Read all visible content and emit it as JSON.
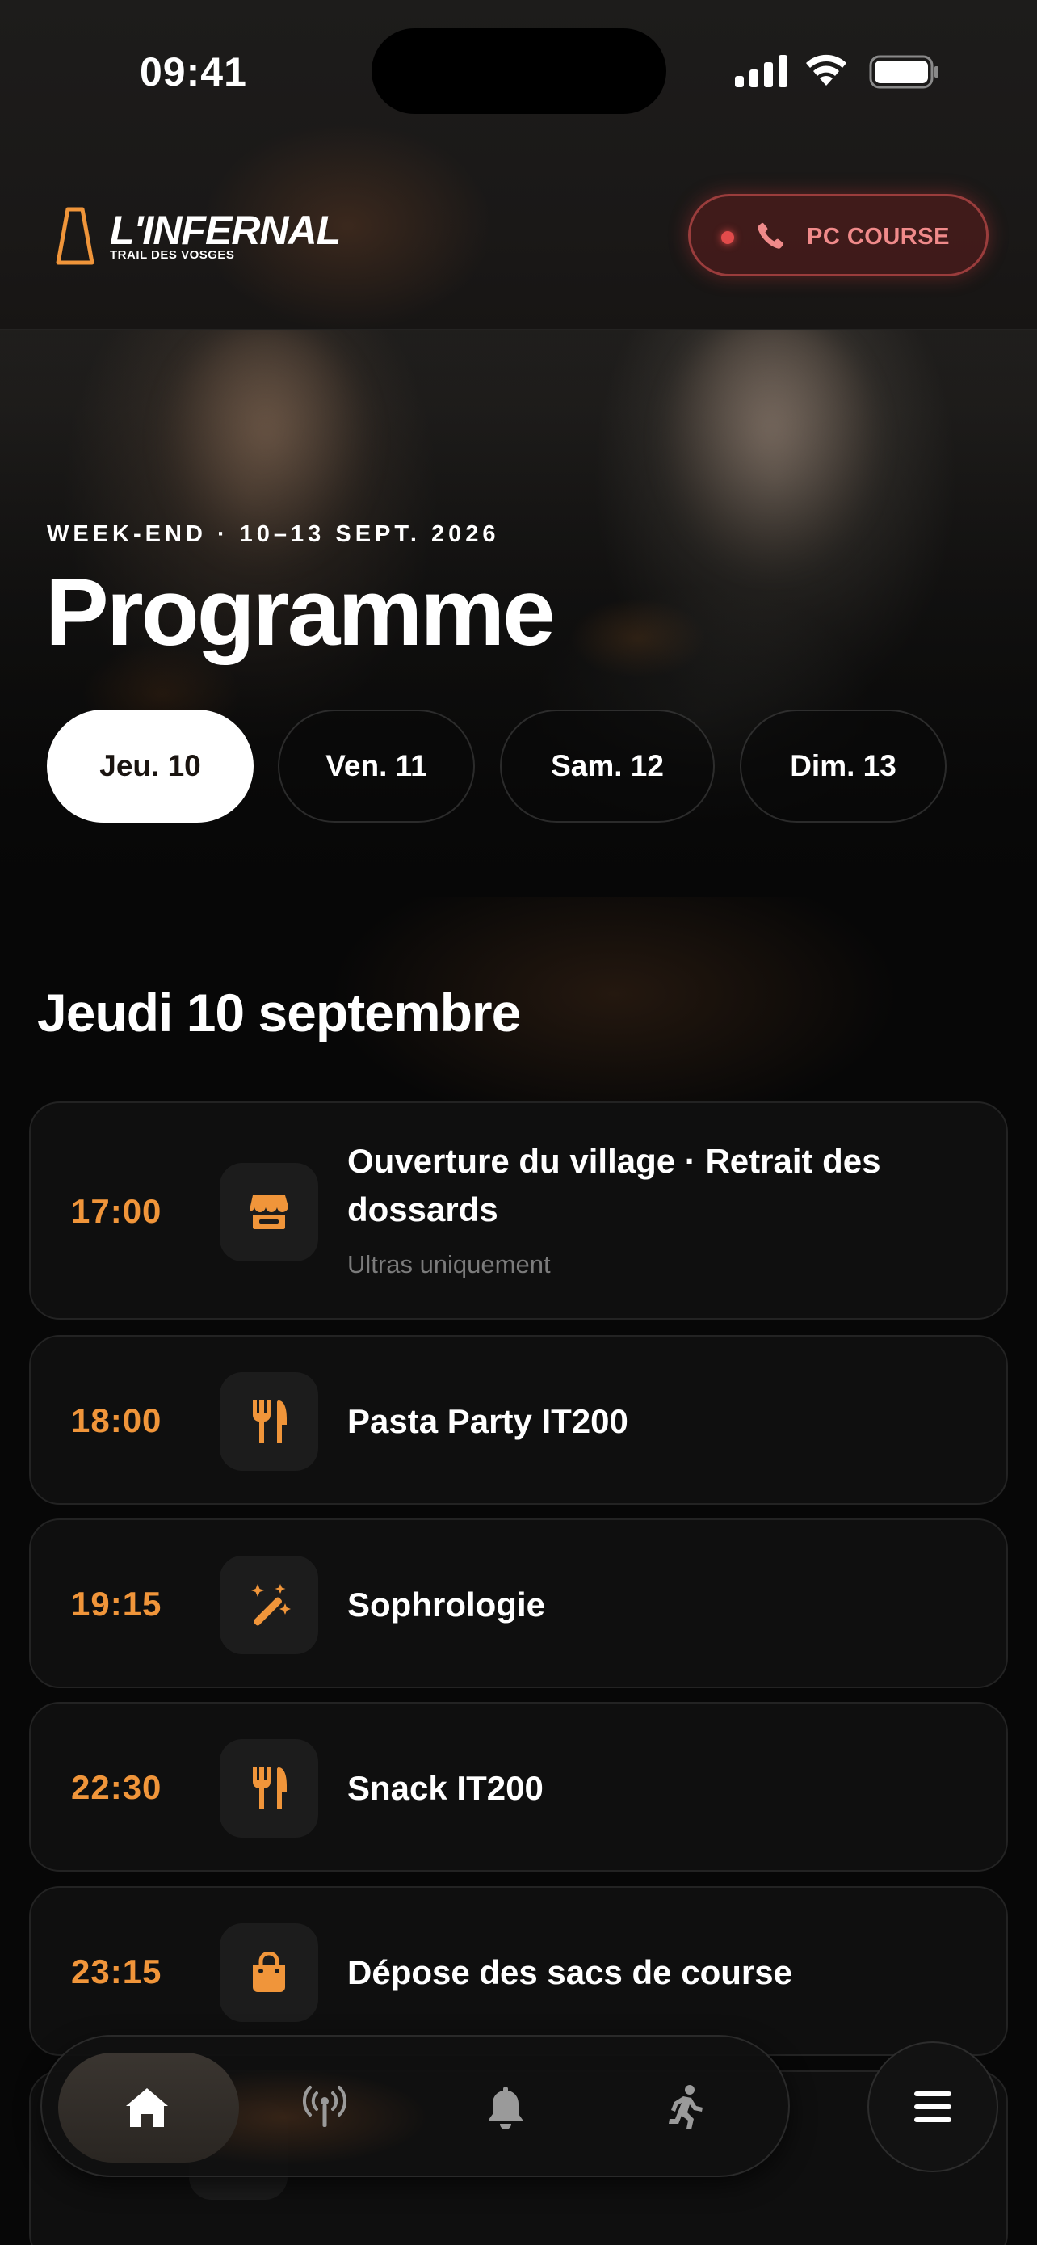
{
  "status_bar": {
    "time": "09:41"
  },
  "header": {
    "logo_text": "L'INFERNAL",
    "logo_subtext": "TRAIL DES VOSGES",
    "pc_button_label": "PC COURSE"
  },
  "hero": {
    "eyebrow": "WEEK-END · 10–13 SEPT. 2026",
    "title": "Programme",
    "days": [
      {
        "label": "Jeu. 10",
        "active": true
      },
      {
        "label": "Ven. 11",
        "active": false
      },
      {
        "label": "Sam. 12",
        "active": false
      },
      {
        "label": "Dim. 13",
        "active": false
      }
    ]
  },
  "schedule": {
    "day_heading": "Jeudi 10 septembre",
    "events": [
      {
        "time": "17:00",
        "icon": "store-icon",
        "title": "Ouverture du village · Retrait des dossards",
        "subtitle": "Ultras uniquement"
      },
      {
        "time": "18:00",
        "icon": "utensils-icon",
        "title": "Pasta Party IT200",
        "subtitle": ""
      },
      {
        "time": "19:15",
        "icon": "magic-wand-icon",
        "title": "Sophrologie",
        "subtitle": ""
      },
      {
        "time": "22:30",
        "icon": "utensils-icon",
        "title": "Snack IT200",
        "subtitle": ""
      },
      {
        "time": "23:15",
        "icon": "bag-icon",
        "title": "Dépose des sacs de course",
        "subtitle": ""
      }
    ]
  },
  "tab_bar": {
    "items": [
      {
        "icon": "home-icon",
        "active": true
      },
      {
        "icon": "broadcast-icon",
        "active": false
      },
      {
        "icon": "bell-icon",
        "active": false
      },
      {
        "icon": "runner-icon",
        "active": false
      }
    ],
    "menu_icon": "menu-icon"
  },
  "colors": {
    "accent": "#f0953a",
    "background": "#070707",
    "card": "#0f0f0f",
    "alert": "#e24b4b"
  }
}
